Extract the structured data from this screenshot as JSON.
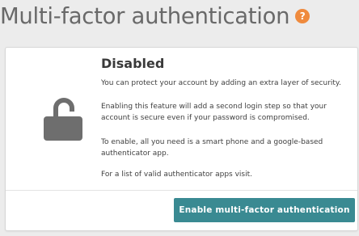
{
  "header": {
    "title": "Multi-factor authentication",
    "help_icon": "?"
  },
  "card": {
    "status_title": "Disabled",
    "lock_icon": "unlocked-padlock-icon",
    "paragraphs": [
      "You can protect your account by adding an extra layer of security.",
      "Enabling this feature will add a second login step so that your account is secure even if your password is compromised.",
      "To enable, all you need is a smart phone and a google-based authenticator app.",
      "For a list of valid authenticator apps visit."
    ],
    "enable_button_label": "Enable multi-factor authentication"
  },
  "colors": {
    "accent": "#3a8a92",
    "help_icon": "#ef8a3d",
    "lock_icon": "#6e6e6e",
    "title_text": "#696969"
  }
}
